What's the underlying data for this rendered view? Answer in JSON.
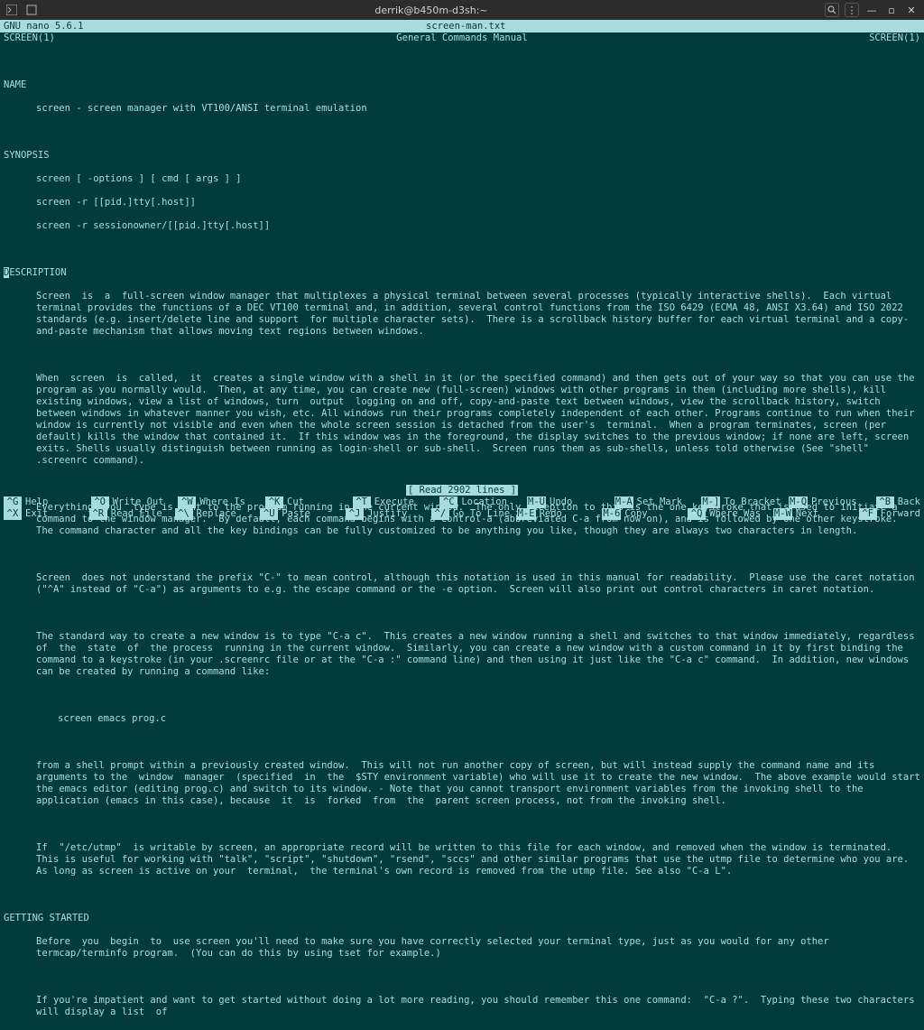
{
  "window": {
    "title": "derrik@b450m-d3sh:~"
  },
  "nano": {
    "version": "GNU nano 5.6.1",
    "filename": "screen-man.txt"
  },
  "manheader": {
    "left": "SCREEN(1)",
    "center": "General Commands Manual",
    "right": "SCREEN(1)"
  },
  "sections": {
    "name_h": "NAME",
    "name_l1": "screen - screen manager with VT100/ANSI terminal emulation",
    "syn_h": "SYNOPSIS",
    "syn_l1": "screen [ -options ] [ cmd [ args ] ]",
    "syn_l2": "screen -r [[pid.]tty[.host]]",
    "syn_l3": "screen -r sessionowner/[[pid.]tty[.host]]",
    "desc_h_pre": "D",
    "desc_h_rest": "ESCRIPTION",
    "desc_p1": "Screen  is  a  full-screen window manager that multiplexes a physical terminal between several processes (typically interactive shells).  Each virtual terminal provides the functions of a DEC VT100 terminal and, in addition, several control functions from the ISO 6429 (ECMA 48, ANSI X3.64) and ISO 2022 standards (e.g. insert/delete line and support  for multiple character sets).  There is a scrollback history buffer for each virtual terminal and a copy-and-paste mechanism that allows moving text regions between windows.",
    "desc_p2": "When  screen  is  called,  it  creates a single window with a shell in it (or the specified command) and then gets out of your way so that you can use the program as you normally would.  Then, at any time, you can create new (full-screen) windows with other programs in them (including more shells), kill existing windows, view a list of windows, turn  output  logging on and off, copy-and-paste text between windows, view the scrollback history, switch between windows in whatever manner you wish, etc. All windows run their programs completely independent of each other. Programs continue to run when their window is currently not visible and even when the whole screen session is detached from the user's  terminal.  When a program terminates, screen (per default) kills the window that contained it.  If this window was in the foreground, the display switches to the previous window; if none are left, screen exits. Shells usually distinguish between running as login-shell or sub-shell.  Screen runs them as sub-shells, unless told otherwise (See \"shell\" .screenrc command).",
    "desc_p3": "Everything  you  type is sent to the program running in the current window.  The only exception to this is the one keystroke that is used to initiate a command to the window manager.  By default, each command begins with a control-a (abbreviated C-a from now on), and is followed by one other keystroke.  The command character and all the key bindings can be fully customized to be anything you like, though they are always two characters in length.",
    "desc_p4": "Screen  does not understand the prefix \"C-\" to mean control, although this notation is used in this manual for readability.  Please use the caret notation (\"^A\" instead of \"C-a\") as arguments to e.g. the escape command or the -e option.  Screen will also print out control characters in caret notation.",
    "desc_p5": "The standard way to create a new window is to type \"C-a c\".  This creates a new window running a shell and switches to that window immediately, regardless of  the  state  of  the process  running in the current window.  Similarly, you can create a new window with a custom command in it by first binding the command to a keystroke (in your .screenrc file or at the \"C-a :\" command line) and then using it just like the \"C-a c\" command.  In addition, new windows can be created by running a command like:",
    "desc_ex": "screen emacs prog.c",
    "desc_p6": "from a shell prompt within a previously created window.  This will not run another copy of screen, but will instead supply the command name and its arguments to the  window  manager  (specified  in  the  $STY environment variable) who will use it to create the new window.  The above example would start the emacs editor (editing prog.c) and switch to its window. - Note that you cannot transport environment variables from the invoking shell to the application (emacs in this case), because  it  is  forked  from  the  parent screen process, not from the invoking shell.",
    "desc_p7": "If  \"/etc/utmp\"  is writable by screen, an appropriate record will be written to this file for each window, and removed when the window is terminated.  This is useful for working with \"talk\", \"script\", \"shutdown\", \"rsend\", \"sccs\" and other similar programs that use the utmp file to determine who you are. As long as screen is active on your  terminal,  the terminal's own record is removed from the utmp file. See also \"C-a L\".",
    "gs_h": "GETTING STARTED",
    "gs_p1": "Before  you  begin  to  use screen you'll need to make sure you have correctly selected your terminal type, just as you would for any other termcap/terminfo program.  (You can do this by using tset for example.)",
    "gs_p2": "If you're impatient and want to get started without doing a lot more reading, you should remember this one command:  \"C-a ?\".  Typing these two characters will display a list  of"
  },
  "status": "[ Read 2902 lines ]",
  "shortcuts": {
    "row1": [
      {
        "k": "^G",
        "l": "Help"
      },
      {
        "k": "^O",
        "l": "Write Out"
      },
      {
        "k": "^W",
        "l": "Where Is"
      },
      {
        "k": "^K",
        "l": "Cut"
      },
      {
        "k": "^T",
        "l": "Execute"
      },
      {
        "k": "^C",
        "l": "Location"
      },
      {
        "k": "M-U",
        "l": "Undo"
      },
      {
        "k": "M-A",
        "l": "Set Mark"
      },
      {
        "k": "M-]",
        "l": "To Bracket"
      },
      {
        "k": "M-Q",
        "l": "Previous"
      }
    ],
    "row2": [
      {
        "k": "^X",
        "l": "Exit"
      },
      {
        "k": "^R",
        "l": "Read File"
      },
      {
        "k": "^\\",
        "l": "Replace"
      },
      {
        "k": "^U",
        "l": "Paste"
      },
      {
        "k": "^J",
        "l": "Justify"
      },
      {
        "k": "^/",
        "l": "Go To Line"
      },
      {
        "k": "M-E",
        "l": "Redo"
      },
      {
        "k": "M-6",
        "l": "Copy"
      },
      {
        "k": "^Q",
        "l": "Where Was"
      },
      {
        "k": "M-W",
        "l": "Next"
      }
    ],
    "row1_extra": {
      "k": "^B",
      "l": "Back"
    },
    "row2_extra": {
      "k": "^F",
      "l": "Forward"
    }
  }
}
